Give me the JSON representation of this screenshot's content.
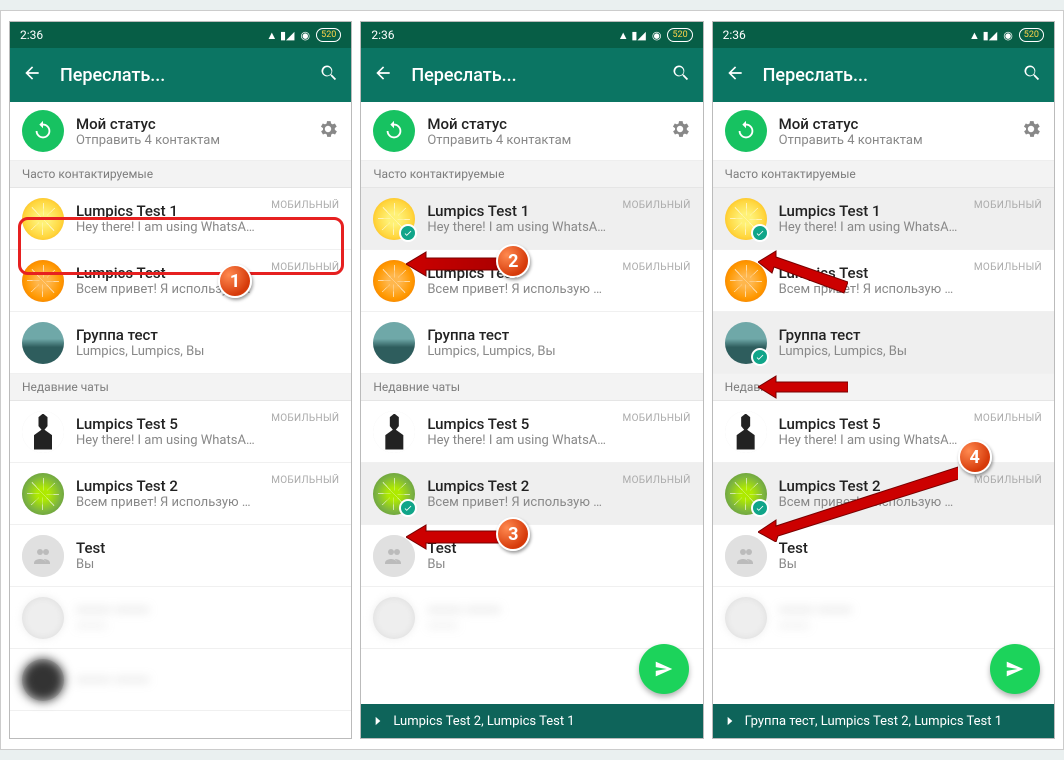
{
  "statusbar": {
    "time": "2:36",
    "battery": "520"
  },
  "appbar": {
    "title": "Переслать..."
  },
  "status_row": {
    "title": "Мой статус",
    "subtitle": "Отправить 4 контактам"
  },
  "section_frequent": "Часто контактируемые",
  "section_recent": "Недавние чаты",
  "tag_mobile": "МОБИЛЬНЫЙ",
  "contacts": {
    "test1": {
      "name": "Lumpics Test 1",
      "sub": "Hey there! I am using WhatsApp."
    },
    "test": {
      "name": "Lumpics Test",
      "sub": "Всем привет! Я использую WhatsApp."
    },
    "group": {
      "name": "Группа тест",
      "sub": "Lumpics, Lumpics, Вы"
    },
    "test5": {
      "name": "Lumpics Test 5",
      "sub": "Hey there! I am using WhatsApp."
    },
    "test2": {
      "name": "Lumpics Test 2",
      "sub": "Всем привет! Я использую WhatsApp."
    },
    "testg": {
      "name": "Test",
      "sub": "Вы"
    }
  },
  "bottom": {
    "panel2": "Lumpics Test 2, Lumpics Test 1",
    "panel3": "Группа тест, Lumpics Test 2, Lumpics Test 1"
  },
  "markers": {
    "m1": "1",
    "m2": "2",
    "m3": "3",
    "m4": "4"
  }
}
